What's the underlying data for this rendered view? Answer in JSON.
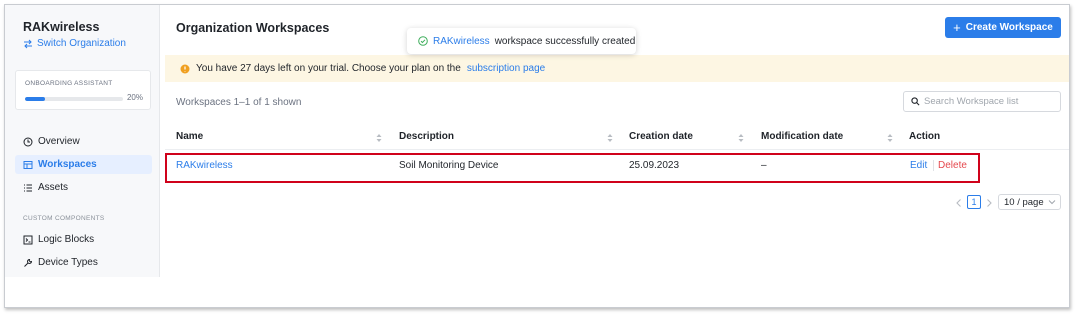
{
  "sidebar": {
    "org_name": "RAKwireless",
    "switch_label": "Switch Organization",
    "onboarding": {
      "title": "ONBOARDING ASSISTANT",
      "progress_text": "20%",
      "progress": 0.2
    },
    "nav": [
      {
        "label": "Overview",
        "icon": "clock-icon"
      },
      {
        "label": "Workspaces",
        "icon": "workspace-icon",
        "active": true
      },
      {
        "label": "Assets",
        "icon": "list-icon"
      }
    ],
    "custom_section_label": "CUSTOM COMPONENTS",
    "custom": [
      {
        "label": "Logic Blocks",
        "icon": "terminal-icon"
      },
      {
        "label": "Device Types",
        "icon": "wrench-icon"
      }
    ]
  },
  "header": {
    "title": "Organization Workspaces",
    "create_button": "Create Workspace"
  },
  "toast": {
    "link": "RAKwireless",
    "message": "workspace successfully created"
  },
  "banner": {
    "text": "You have 27 days left on your trial. Choose your plan on the",
    "link": "subscription page"
  },
  "table": {
    "count_text": "Workspaces 1–1 of 1 shown",
    "search_placeholder": "Search Workspace list",
    "columns": [
      "Name",
      "Description",
      "Creation date",
      "Modification date",
      "Action"
    ],
    "rows": [
      {
        "name": "RAKwireless",
        "description": "Soil Monitoring Device",
        "created": "25.09.2023",
        "modified": "–",
        "edit": "Edit",
        "delete": "Delete"
      }
    ]
  },
  "pagination": {
    "current_page": "1",
    "page_size": "10 / page"
  },
  "colors": {
    "accent": "#2b7de9",
    "danger": "#e5484d",
    "highlight": "#d0021b",
    "banner_bg": "#fdf6e3"
  }
}
